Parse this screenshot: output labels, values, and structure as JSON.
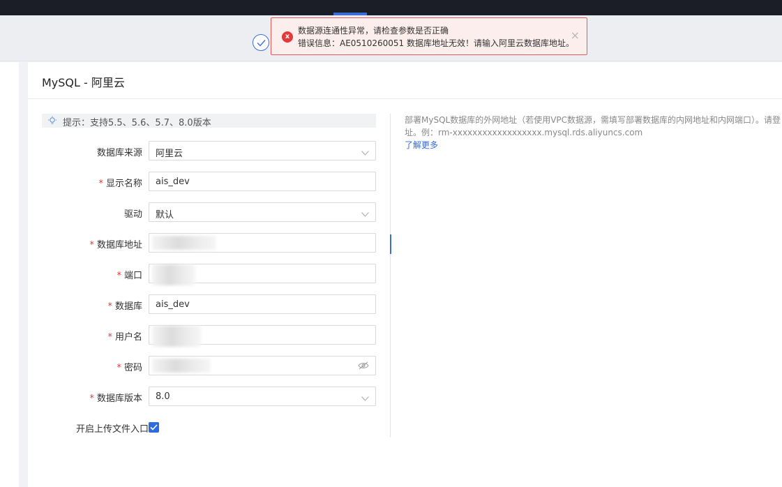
{
  "toast": {
    "title": "数据源连通性异常，请检查参数是否正确",
    "detail": "错误信息：AE0510260051 数据库地址无效！请输入阿里云数据库地址。",
    "icon": "error-icon",
    "close_glyph": "×"
  },
  "panel": {
    "title": "MySQL - 阿里云"
  },
  "tip": {
    "text": "提示：支持5.5、5.6、5.7、8.0版本"
  },
  "form": {
    "source": {
      "label": "数据库来源",
      "value": "阿里云",
      "required": false
    },
    "display_name": {
      "label": "显示名称",
      "value": "ais_dev",
      "required": true
    },
    "driver": {
      "label": "驱动",
      "value": "默认",
      "required": false
    },
    "db_address": {
      "label": "数据库地址",
      "value": "",
      "required": true
    },
    "port": {
      "label": "端口",
      "value": "",
      "required": true
    },
    "database": {
      "label": "数据库",
      "value": "ais_dev",
      "required": true
    },
    "username": {
      "label": "用户名",
      "value": "",
      "required": true
    },
    "password": {
      "label": "密码",
      "value": "",
      "required": true
    },
    "db_version": {
      "label": "数据库版本",
      "value": "8.0",
      "required": true
    },
    "upload_entry": {
      "label": "开启上传文件入口",
      "checked": true
    }
  },
  "help": {
    "line1": "部署MySQL数据库的外网地址（若使用VPC数据源，需填写部署数据库的内网地址和内网端口）。请登",
    "line2": "址。例：rm-xxxxxxxxxxxxxxxxxx.mysql.rds.aliyuncs.com",
    "more_link": "了解更多"
  },
  "required_mark": "*",
  "colors": {
    "accent": "#2f6be0",
    "error": "#e33a3a",
    "topbar": "#1b1e27"
  }
}
